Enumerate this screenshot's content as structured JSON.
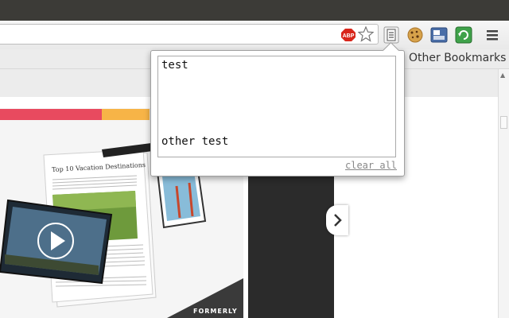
{
  "bookmarks_bar": {
    "other_bookmarks_label": "Other Bookmarks"
  },
  "toolbar": {
    "abp_label": "ABP",
    "icons": [
      "adblock-plus-icon",
      "star-icon",
      "notes-extension-icon",
      "cookie-icon",
      "panel-extension-icon",
      "refresh-extension-icon",
      "menu-icon"
    ]
  },
  "popup": {
    "notes_text": "test\n\n\n\n\n\nother test",
    "clear_all_label": "clear all"
  },
  "page_preview": {
    "card_title": "Top 10 Vacation Destinations",
    "banner_text": "FORMERLY"
  },
  "colors": {
    "band_red": "#e84a5f",
    "band_orange": "#f7b447",
    "titlebar": "#3c3b37"
  }
}
